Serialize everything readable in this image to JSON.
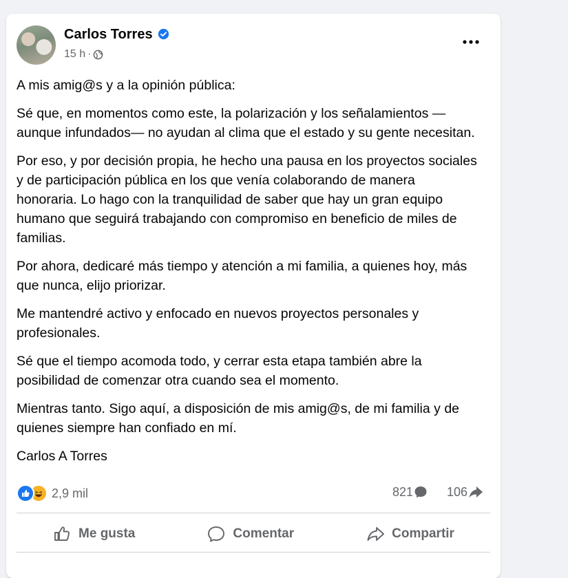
{
  "post": {
    "author": "Carlos Torres",
    "time": "15 h",
    "separator": "·",
    "icons": {
      "verified": "verified-badge-icon",
      "audience": "globe-icon",
      "more": "more-options-icon"
    },
    "paragraphs": [
      "A mis amig@s y a la opinión pública:",
      "Sé que, en momentos como este, la polarización y los señalamientos —aunque infundados— no ayudan al clima que el estado y su gente necesitan.",
      "Por eso, y por decisión propia, he hecho una pausa en los proyectos sociales y de participación pública en los que venía colaborando de manera honoraria. Lo hago con la tranquilidad de saber que hay un gran equipo humano que seguirá trabajando con compromiso en beneficio de miles de familias.",
      "Por ahora, dedicaré más tiempo y atención a mi familia, a quienes hoy, más que nunca, elijo priorizar.",
      "Me mantendré activo y enfocado en nuevos proyectos personales y profesionales.",
      "Sé que el tiempo acomoda todo, y cerrar esta etapa también abre la posibilidad de comenzar otra cuando sea el momento.",
      "Mientras tanto. Sigo aquí, a disposición de mis amig@s, de mi familia y de quienes siempre han confiado en mí.",
      "Carlos A Torres"
    ],
    "stats": {
      "reactions": "2,9 mil",
      "comments": "821",
      "shares": "106"
    },
    "actions": {
      "like": "Me gusta",
      "comment": "Comentar",
      "share": "Compartir"
    }
  },
  "colors": {
    "verified": "#1877f2",
    "like_reaction": "#1877f2",
    "haha_reaction": "#f7b125",
    "secondary_text": "#65676b"
  }
}
